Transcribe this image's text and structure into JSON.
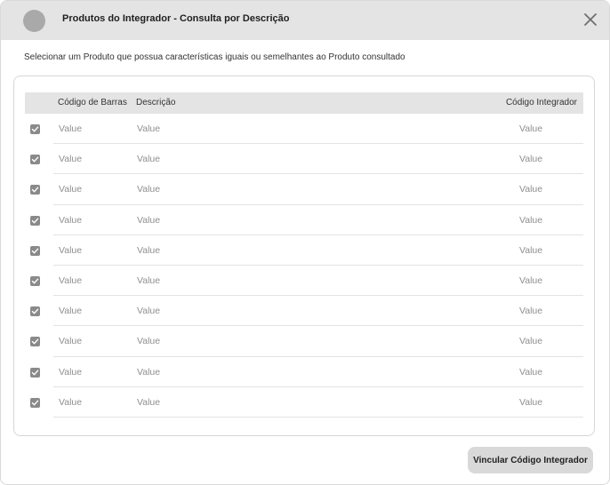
{
  "dialog": {
    "title": "Produtos do Integrador - Consulta por Descrição",
    "subtitle": "Selecionar um Produto que possua características iguais ou semelhantes ao Produto consultado",
    "close_icon": "close-icon"
  },
  "table": {
    "columns": {
      "barcode": "Código de Barras",
      "description": "Descrição",
      "integrator_code": "Código Integrador"
    },
    "rows": [
      {
        "checked": true,
        "barcode": "Value",
        "description": "Value",
        "integrator_code": "Value"
      },
      {
        "checked": true,
        "barcode": "Value",
        "description": "Value",
        "integrator_code": "Value"
      },
      {
        "checked": true,
        "barcode": "Value",
        "description": "Value",
        "integrator_code": "Value"
      },
      {
        "checked": true,
        "barcode": "Value",
        "description": "Value",
        "integrator_code": "Value"
      },
      {
        "checked": true,
        "barcode": "Value",
        "description": "Value",
        "integrator_code": "Value"
      },
      {
        "checked": true,
        "barcode": "Value",
        "description": "Value",
        "integrator_code": "Value"
      },
      {
        "checked": true,
        "barcode": "Value",
        "description": "Value",
        "integrator_code": "Value"
      },
      {
        "checked": true,
        "barcode": "Value",
        "description": "Value",
        "integrator_code": "Value"
      },
      {
        "checked": true,
        "barcode": "Value",
        "description": "Value",
        "integrator_code": "Value"
      },
      {
        "checked": true,
        "barcode": "Value",
        "description": "Value",
        "integrator_code": "Value"
      }
    ]
  },
  "actions": {
    "link_button": "Vincular Código Integrador"
  },
  "colors": {
    "header_bg": "#e4e4e4",
    "checkbox": "#8a8a8a",
    "button_bg": "#d9d9d9"
  }
}
